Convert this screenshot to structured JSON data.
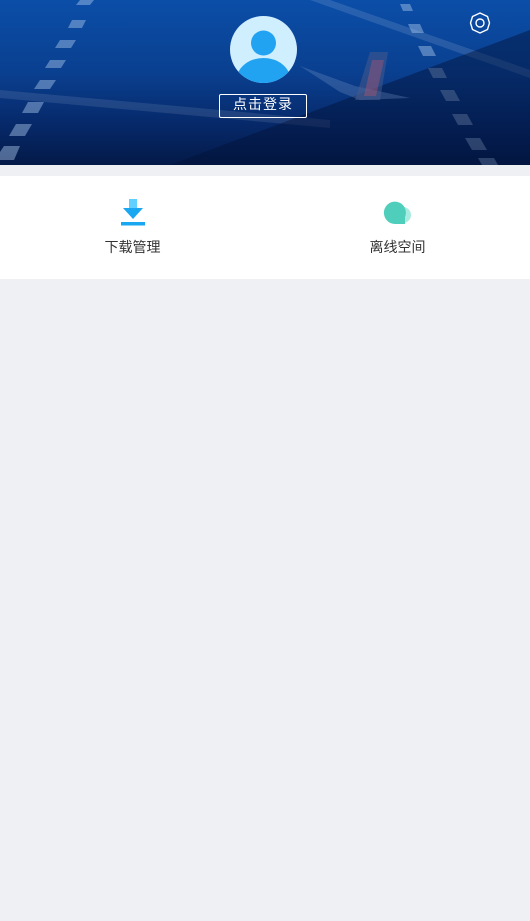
{
  "header": {
    "login_label": "点击登录",
    "settings_icon": "settings-gear-icon",
    "avatar_icon": "default-user-avatar"
  },
  "quick_actions": [
    {
      "label": "下载管理",
      "icon": "download-icon",
      "color": "#1aa7f2"
    },
    {
      "label": "离线空间",
      "icon": "cloud-icon",
      "color": "#4fcfbb"
    }
  ],
  "colors": {
    "header_top": "#0b4ea8",
    "header_bottom": "#041a48",
    "page_background": "#eef0f3"
  }
}
